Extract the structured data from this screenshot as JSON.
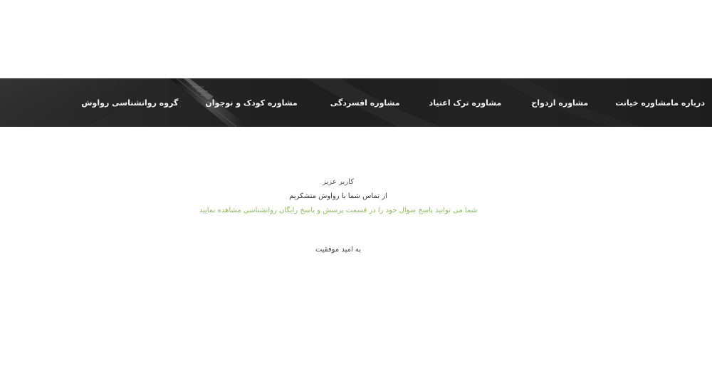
{
  "nav": {
    "brand": "گروه روانشناسی رواوش",
    "items": [
      "مشاوره کودک و نوجوان",
      "مشاوره افسردگی",
      "مشاوره ترک اعتیاد",
      "مشاوره ازدواج",
      "مشاوره خیانت",
      "درباره ما"
    ]
  },
  "message": {
    "greeting": "کاربر عزیز",
    "thanks": "از تماس شما با رواوش متشکریم",
    "info": "شما می توانید پاسخ سوال خود را در قسمت پرسش و پاسخ رایگان روانشناسی مشاهده نمایید",
    "closing": "به امید موفقیت"
  },
  "colors": {
    "nav_background": "#222222",
    "nav_text": "#f2f2f2",
    "accent_green": "#8bc34a",
    "body_text": "#333333"
  }
}
